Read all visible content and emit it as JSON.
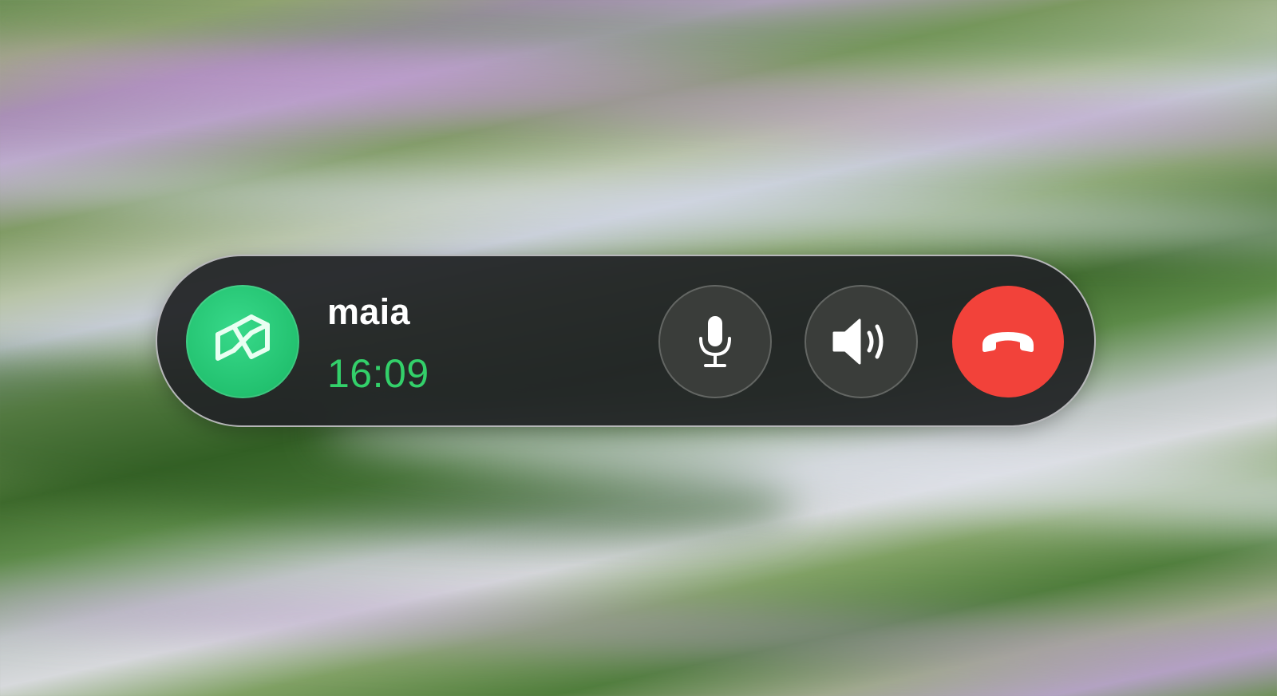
{
  "call": {
    "contact_name": "maia",
    "duration": "16:09"
  },
  "avatar": {
    "icon": "app-logo-icon",
    "color": "#22c16f"
  },
  "controls": {
    "mute": {
      "icon": "microphone-icon"
    },
    "speaker": {
      "icon": "speaker-icon"
    },
    "end_call": {
      "icon": "phone-hangup-icon",
      "color": "#f2423a"
    }
  },
  "colors": {
    "timer": "#33d06a",
    "panel": "#222426"
  }
}
